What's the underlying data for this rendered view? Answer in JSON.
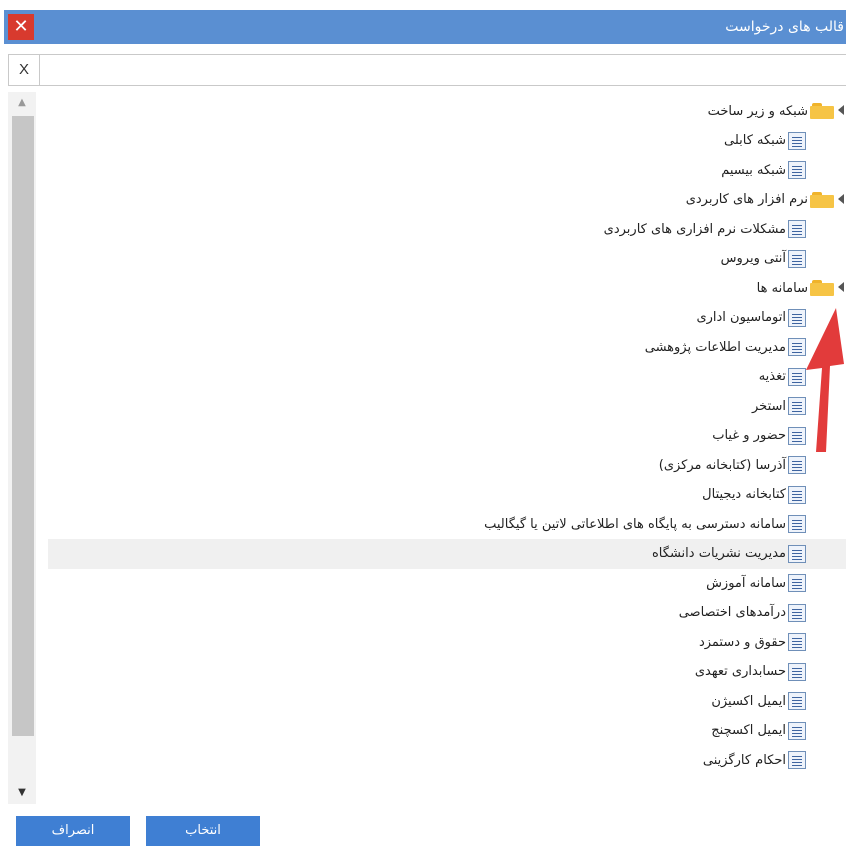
{
  "window": {
    "title": "قالب های درخواست",
    "close_label": "✕"
  },
  "search": {
    "clear_label": "X",
    "value": "",
    "placeholder": ""
  },
  "tree": [
    {
      "label": "شبکه و زیر ساخت",
      "type": "folder",
      "level": 0,
      "expanded": true
    },
    {
      "label": "شبکه کابلی",
      "type": "doc",
      "level": 1
    },
    {
      "label": "شبکه بیسیم",
      "type": "doc",
      "level": 1
    },
    {
      "label": "نرم افزار های کاربردی",
      "type": "folder",
      "level": 0,
      "expanded": true
    },
    {
      "label": "مشکلات نرم افزاری های کاربردی",
      "type": "doc",
      "level": 1
    },
    {
      "label": "آنتی ویروس",
      "type": "doc",
      "level": 1
    },
    {
      "label": "سامانه ها",
      "type": "folder",
      "level": 0,
      "expanded": true
    },
    {
      "label": "اتوماسیون اداری",
      "type": "doc",
      "level": 1
    },
    {
      "label": "مدیریت اطلاعات پژوهشی",
      "type": "doc",
      "level": 1
    },
    {
      "label": "تغذیه",
      "type": "doc",
      "level": 1
    },
    {
      "label": "استخر",
      "type": "doc",
      "level": 1
    },
    {
      "label": "حضور و غیاب",
      "type": "doc",
      "level": 1
    },
    {
      "label": "آذرسا (کتابخانه مرکزی)",
      "type": "doc",
      "level": 1
    },
    {
      "label": "کتابخانه دیجیتال",
      "type": "doc",
      "level": 1
    },
    {
      "label": "سامانه دسترسی به پایگاه های اطلاعاتی لاتین یا گیگالیب",
      "type": "doc",
      "level": 1
    },
    {
      "label": "مدیریت نشریات دانشگاه",
      "type": "doc",
      "level": 1,
      "highlighted": true
    },
    {
      "label": "سامانه آموزش",
      "type": "doc",
      "level": 1
    },
    {
      "label": "درآمدهای اختصاصی",
      "type": "doc",
      "level": 1
    },
    {
      "label": "حقوق و دستمزد",
      "type": "doc",
      "level": 1
    },
    {
      "label": "حسابداری تعهدی",
      "type": "doc",
      "level": 1
    },
    {
      "label": "ایمیل اکسیژن",
      "type": "doc",
      "level": 1
    },
    {
      "label": "ایمیل اکسچنج",
      "type": "doc",
      "level": 1
    },
    {
      "label": "احکام کارگزینی",
      "type": "doc",
      "level": 1
    }
  ],
  "footer": {
    "select_label": "انتخاب",
    "cancel_label": "انصراف"
  },
  "colors": {
    "titlebar": "#5a8fd2",
    "close": "#d83a2e",
    "button": "#3f7fd3",
    "folder": "#f6c445",
    "arrow": "#e23b3b"
  }
}
